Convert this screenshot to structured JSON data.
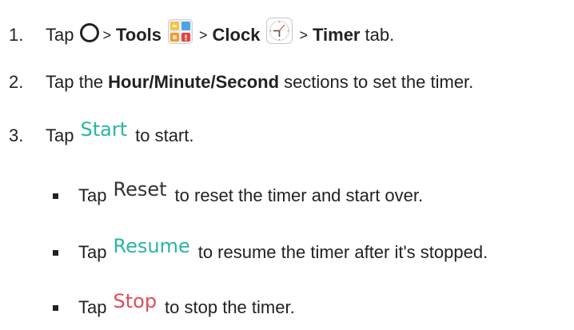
{
  "steps": [
    {
      "number": "1.",
      "tap": "Tap",
      "gt1": ">",
      "tools": "Tools",
      "gt2": ">",
      "clock": "Clock",
      "gt3": ">",
      "timer": "Timer",
      "tab_suffix": "tab."
    },
    {
      "number": "2.",
      "prefix": "Tap the",
      "bold": "Hour/Minute/Second",
      "suffix": "sections to set the timer."
    },
    {
      "number": "3.",
      "prefix": "Tap",
      "keyword": "Start",
      "suffix": "to start."
    }
  ],
  "subitems": [
    {
      "prefix": "Tap",
      "keyword": "Reset",
      "suffix": "to reset the timer and start over."
    },
    {
      "prefix": "Tap",
      "keyword": "Resume",
      "suffix": "to resume the timer after it's stopped."
    },
    {
      "prefix": "Tap",
      "keyword": "Stop",
      "suffix": "to stop the timer."
    }
  ],
  "icons": {
    "home": "home-circle-icon",
    "tools": "tools-folder-icon",
    "clock": "clock-app-icon"
  },
  "colors": {
    "keyword_teal": "#2bb5a3",
    "keyword_dark": "#333333",
    "text": "#222222"
  }
}
